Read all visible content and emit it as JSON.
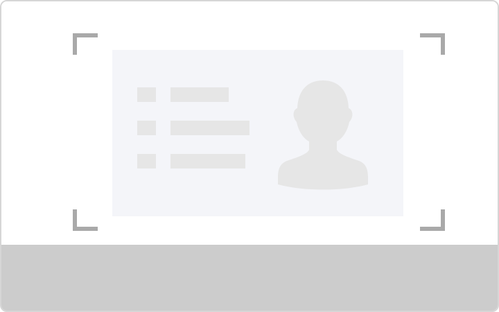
{
  "screen": {
    "description_hidden": "",
    "icons": {
      "frame_corners": "viewfinder-corner-icon",
      "avatar": "person-silhouette-icon"
    },
    "colors": {
      "frame_border": "#d6d6d6",
      "corner": "#a9a9a9",
      "card_background": "#f4f5f9",
      "placeholder": "#e6e6e6",
      "bottom_bar": "#cccccc"
    }
  }
}
